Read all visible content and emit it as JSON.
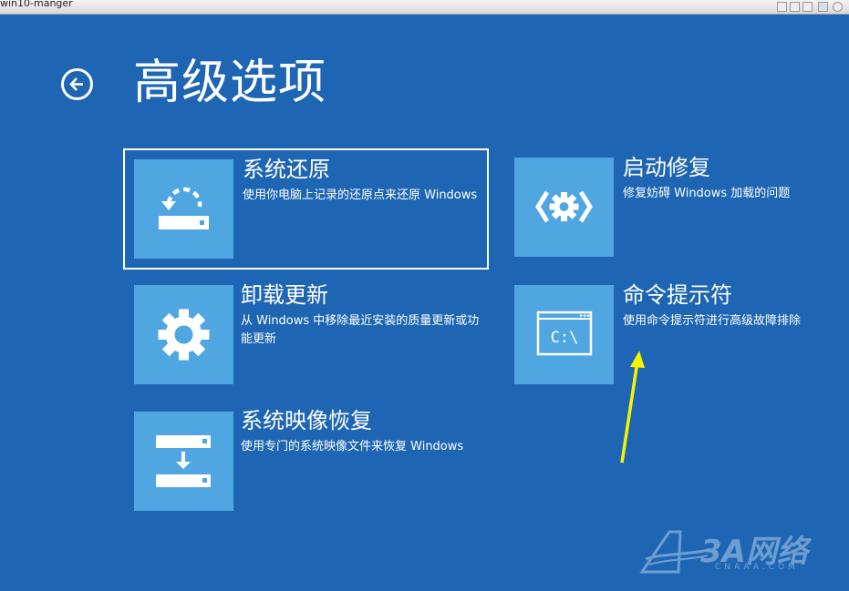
{
  "window": {
    "title": "win10-manger"
  },
  "header": {
    "title": "高级选项"
  },
  "options": [
    {
      "id": "system-restore",
      "title": "系统还原",
      "description": "使用你电脑上记录的还原点来还原 Windows",
      "icon": "system-restore-icon",
      "selected": true
    },
    {
      "id": "startup-repair",
      "title": "启动修复",
      "description": "修复妨碍 Windows 加载的问题",
      "icon": "startup-repair-icon",
      "selected": false
    },
    {
      "id": "uninstall-updates",
      "title": "卸载更新",
      "description": "从 Windows 中移除最近安装的质量更新或功能更新",
      "icon": "gear-icon",
      "selected": false
    },
    {
      "id": "command-prompt",
      "title": "命令提示符",
      "description": "使用命令提示符进行高级故障排除",
      "icon": "command-prompt-icon",
      "icon_text": "C:\\",
      "selected": false
    },
    {
      "id": "system-image-recovery",
      "title": "系统映像恢复",
      "description": "使用专门的系统映像文件来恢复 Windows",
      "icon": "system-image-icon",
      "selected": false
    }
  ],
  "watermark": {
    "text": "3A网络",
    "subtext": "CNAAA.COM"
  },
  "colors": {
    "background": "#1e66b3",
    "tile": "#4fa6e0",
    "text": "#ffffff",
    "annotation_arrow": "#f5f500"
  }
}
